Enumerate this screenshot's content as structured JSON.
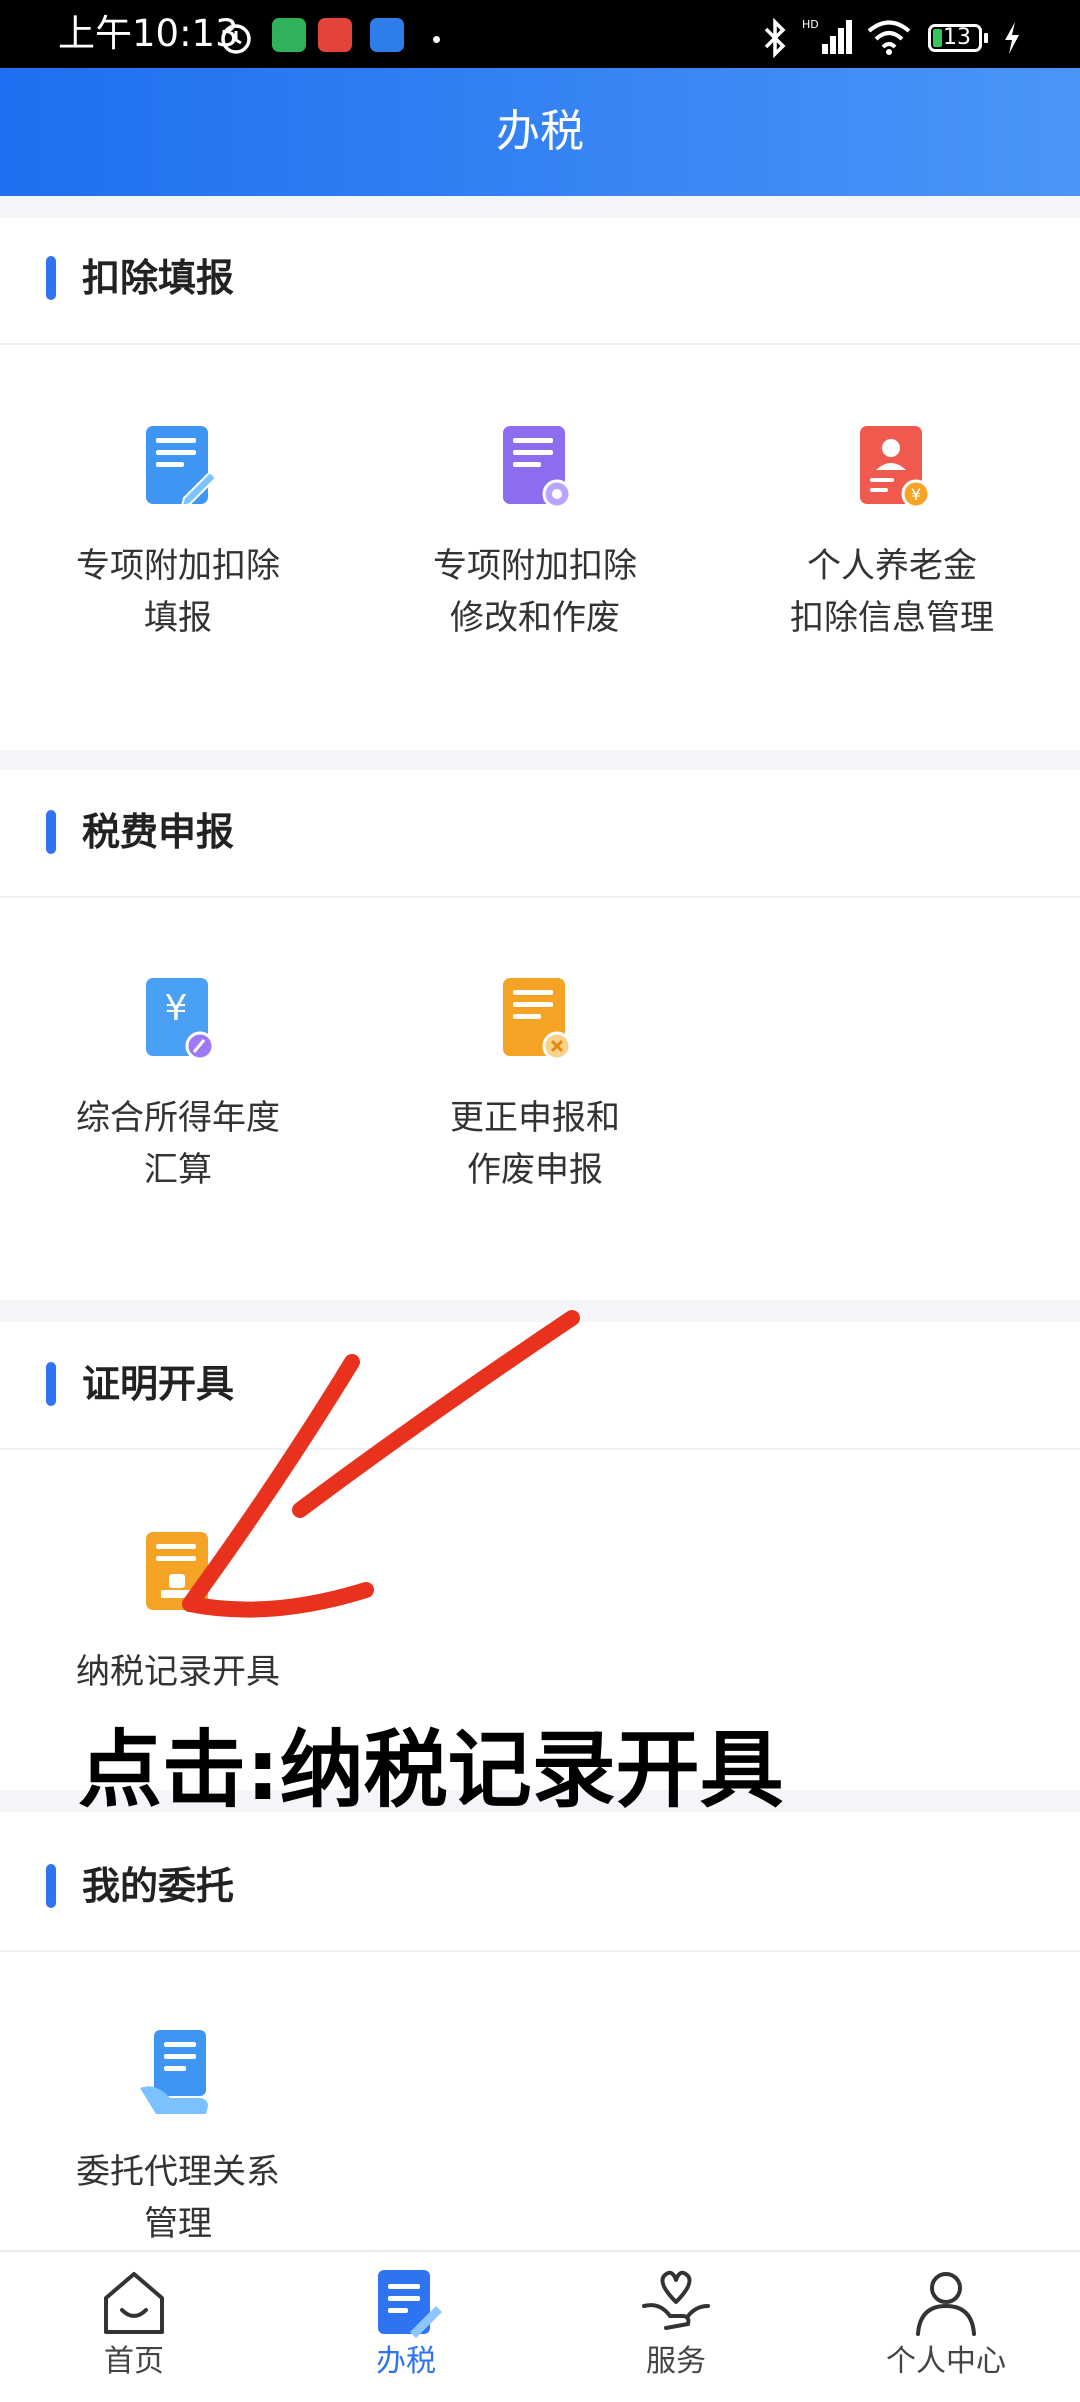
{
  "status_bar": {
    "time": "上午10:13",
    "battery": "13"
  },
  "header": {
    "title": "办税"
  },
  "sections": [
    {
      "title": "扣除填报",
      "items": [
        {
          "label": "专项附加扣除\n填报",
          "icon": "document-edit-icon",
          "color": "#3f95f2"
        },
        {
          "label": "专项附加扣除\n修改和作废",
          "icon": "document-settings-icon",
          "color": "#8e6cf0"
        },
        {
          "label": "个人养老金\n扣除信息管理",
          "icon": "pension-card-icon",
          "color": "#f05a4e"
        }
      ]
    },
    {
      "title": "税费申报",
      "items": [
        {
          "label": "综合所得年度\n汇算",
          "icon": "yuan-document-icon",
          "color": "#3f95f2"
        },
        {
          "label": "更正申报和\n作废申报",
          "icon": "document-cancel-icon",
          "color": "#f5a324"
        }
      ]
    },
    {
      "title": "证明开具",
      "items": [
        {
          "label": "纳税记录开具",
          "icon": "certificate-icon",
          "color": "#f5a324"
        }
      ]
    },
    {
      "title": "我的委托",
      "items": [
        {
          "label": "委托代理关系\n管理",
          "icon": "delegation-icon",
          "color": "#3f95f2"
        }
      ]
    }
  ],
  "annotation": {
    "text": "点击:纳税记录开具",
    "arrow_color": "#e8321e"
  },
  "tabbar": {
    "items": [
      {
        "label": "首页",
        "icon": "home-icon"
      },
      {
        "label": "办税",
        "icon": "tax-icon",
        "active": true
      },
      {
        "label": "服务",
        "icon": "service-icon"
      },
      {
        "label": "个人中心",
        "icon": "profile-icon"
      }
    ]
  },
  "colors": {
    "accent": "#2e74f0",
    "header_start": "#1f6ff0",
    "header_end": "#4b95f7"
  }
}
